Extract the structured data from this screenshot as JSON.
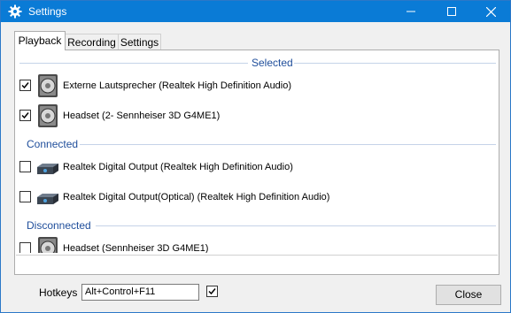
{
  "window": {
    "title": "Settings",
    "app_icon": "gear-icon",
    "controls": [
      "minimize-icon",
      "maximize-icon",
      "close-icon"
    ]
  },
  "tabs": [
    {
      "label": "Playback",
      "active": true
    },
    {
      "label": "Recording",
      "active": false
    },
    {
      "label": "Settings",
      "active": false
    }
  ],
  "groups": {
    "selected": "Selected",
    "connected": "Connected",
    "disconnected": "Disconnected"
  },
  "devices": [
    {
      "label": "Externe Lautsprecher (Realtek High Definition Audio)",
      "checked": true,
      "icon": "speaker-icon"
    },
    {
      "label": "Headset (2- Sennheiser 3D G4ME1)",
      "checked": true,
      "icon": "speaker-icon"
    },
    {
      "label": "Realtek Digital Output (Realtek High Definition Audio)",
      "checked": false,
      "icon": "digital-output-icon"
    },
    {
      "label": "Realtek Digital Output(Optical) (Realtek High Definition Audio)",
      "checked": false,
      "icon": "digital-output-icon"
    },
    {
      "label": "Headset (Sennheiser 3D G4ME1)",
      "checked": false,
      "icon": "speaker-icon"
    }
  ],
  "footer": {
    "hotkeys_label": "Hotkeys",
    "hotkeys_value": "Alt+Control+F11",
    "hotkeys_enabled": true,
    "close_label": "Close"
  },
  "colors": {
    "titlebar": "#0a7bd6",
    "group_text": "#1f4e9b"
  }
}
